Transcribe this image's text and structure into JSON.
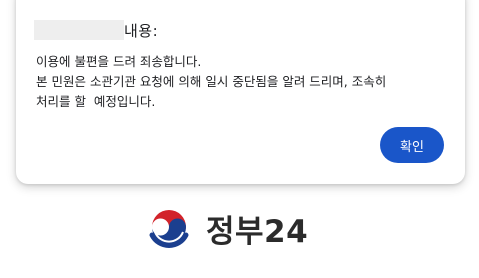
{
  "dialog": {
    "title": "내용:",
    "message": "이용에 불편을 드려 죄송합니다.\n본 민원은 소관기관 요청에 의해 일시 중단됨을 알려 드리며, 조속히\n처리를 할  예정입니다.",
    "confirm_label": "확인"
  },
  "logo": {
    "text": "정부24",
    "icon": "taegeuk-emblem-icon"
  },
  "colors": {
    "button_bg": "#1a56c9",
    "emblem_red": "#d2232a",
    "emblem_blue": "#1b3f8f"
  }
}
